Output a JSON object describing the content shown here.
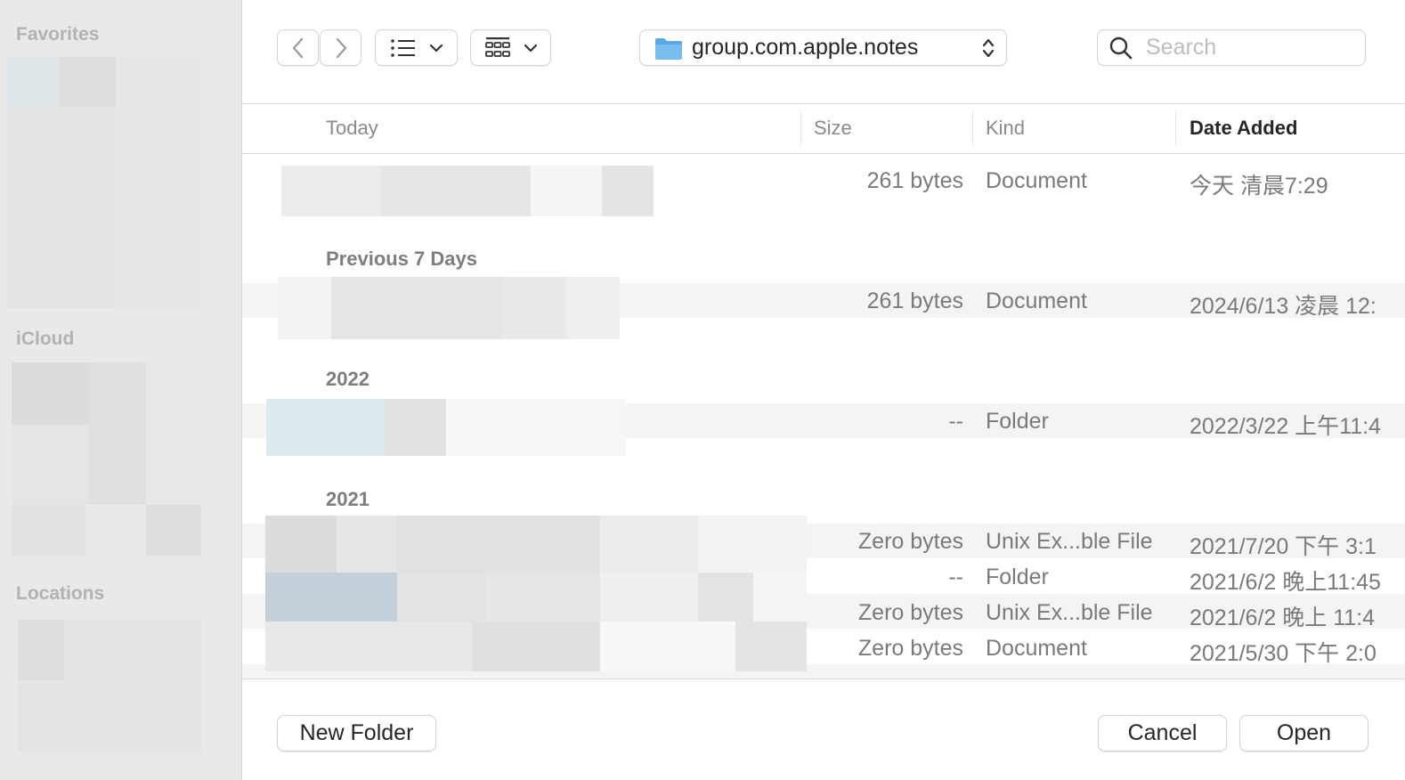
{
  "sidebar": {
    "favorites_heading": "Favorites",
    "icloud_heading": "iCloud",
    "locations_heading": "Locations"
  },
  "toolbar": {
    "path_label": "group.com.apple.notes",
    "search_placeholder": "Search"
  },
  "columns": {
    "name": "Today",
    "size": "Size",
    "kind": "Kind",
    "date_added": "Date Added"
  },
  "groups": {
    "previous7": "Previous 7 Days",
    "y2022": "2022",
    "y2021": "2021"
  },
  "rows": [
    {
      "size": "261 bytes",
      "kind": "Document",
      "date": "今天 清晨7:29"
    },
    {
      "size": "261 bytes",
      "kind": "Document",
      "date": "2024/6/13 凌晨 12:"
    },
    {
      "size": "--",
      "kind": "Folder",
      "date": "2022/3/22 上午11:4"
    },
    {
      "size": "Zero bytes",
      "kind": "Unix Ex...ble File",
      "date": "2021/7/20 下午 3:1"
    },
    {
      "size": "--",
      "kind": "Folder",
      "date": "2021/6/2 晚上11:45"
    },
    {
      "size": "Zero bytes",
      "kind": "Unix Ex...ble File",
      "date": "2021/6/2 晚上 11:4"
    },
    {
      "size": "Zero bytes",
      "kind": "Document",
      "date": "2021/5/30 下午 2:0"
    }
  ],
  "buttons": {
    "new_folder": "New Folder",
    "cancel": "Cancel",
    "open": "Open"
  }
}
